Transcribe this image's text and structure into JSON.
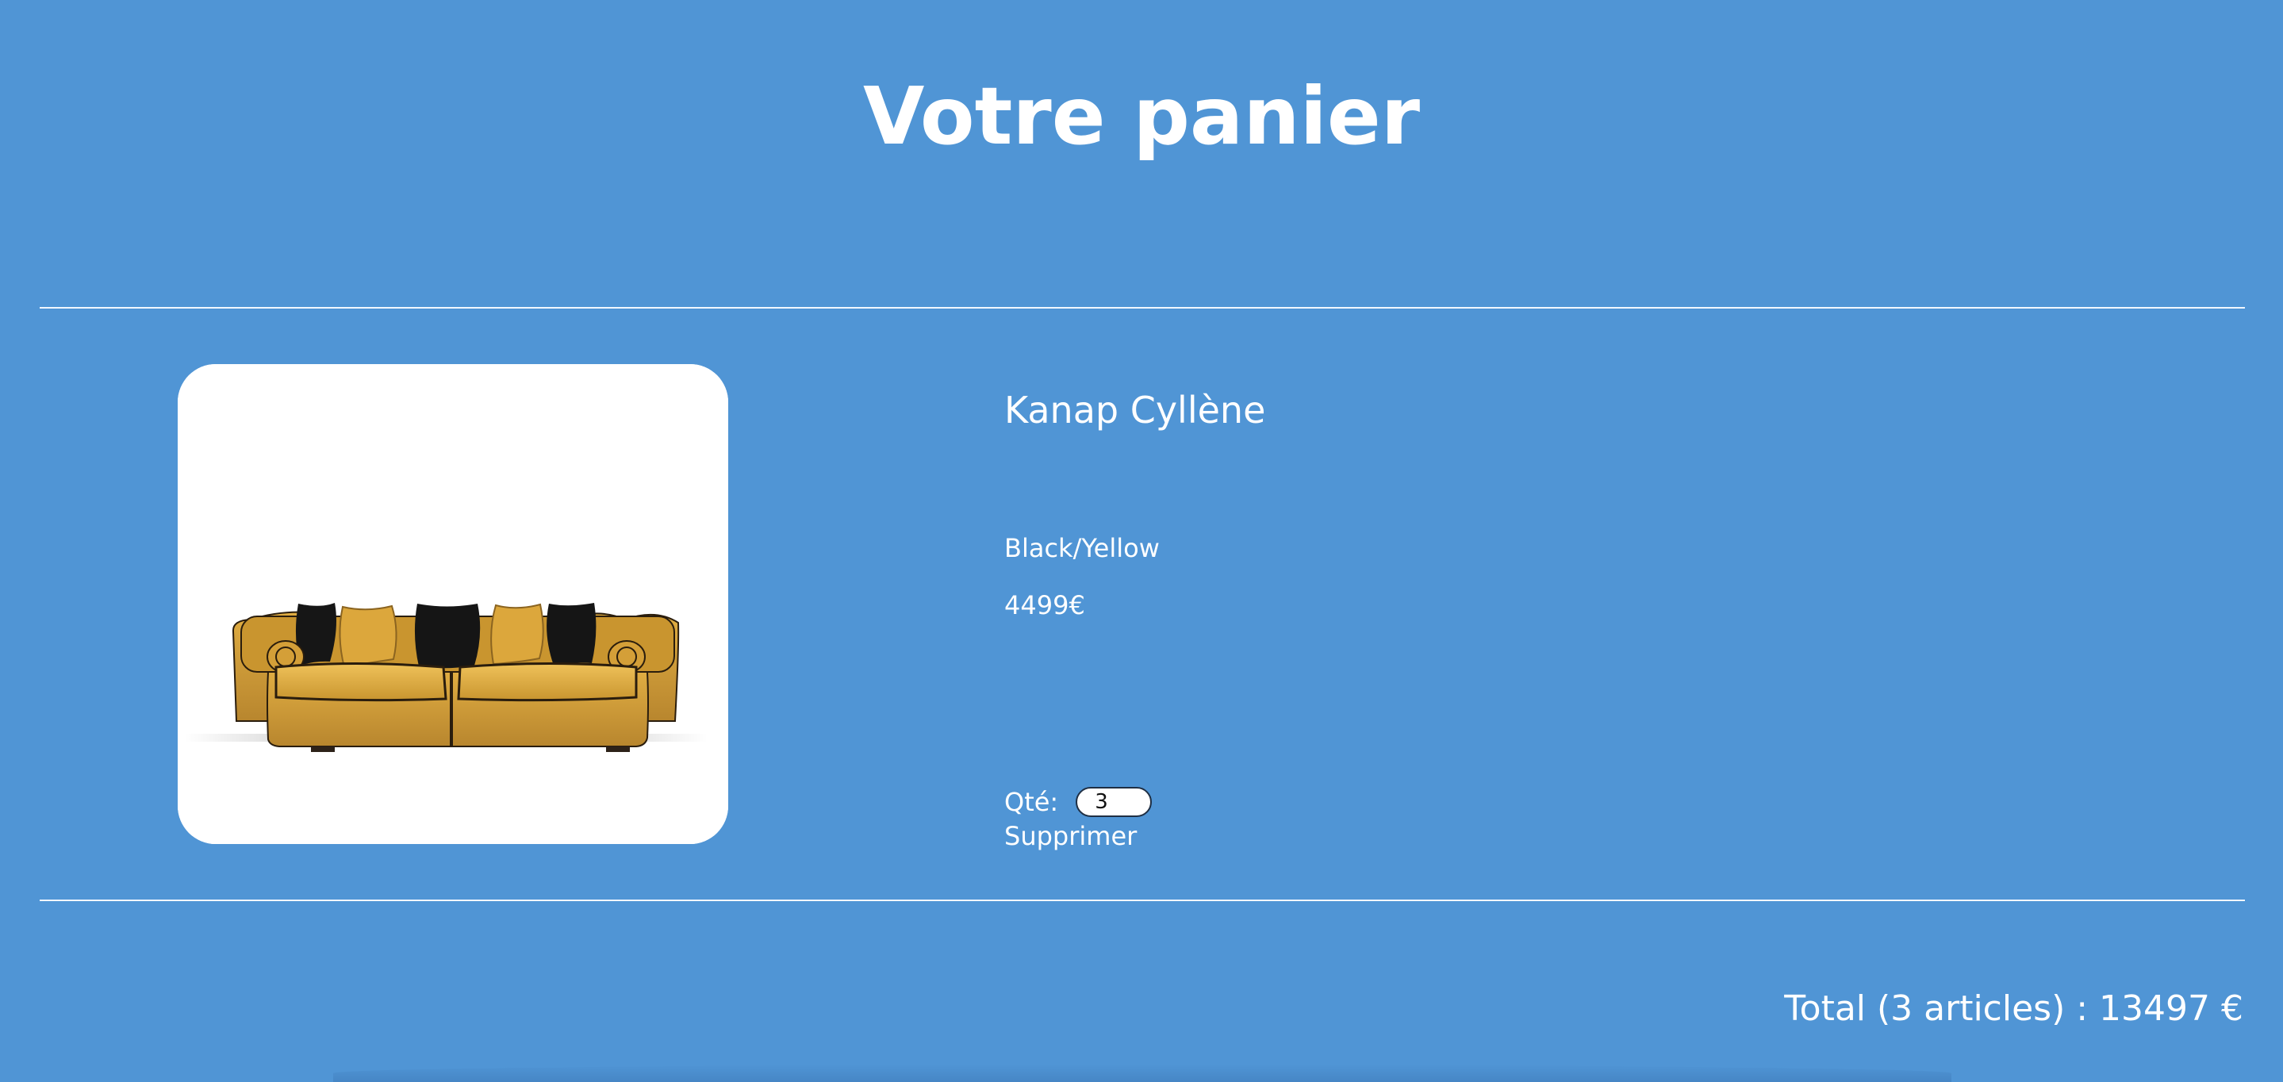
{
  "header": {
    "title": "Votre panier"
  },
  "cart": {
    "items": [
      {
        "name": "Kanap Cyllène",
        "color": "Black/Yellow",
        "price": "4499€",
        "quantity_label": "Qté:",
        "quantity_value": "3",
        "delete_label": "Supprimer",
        "image_icon": "sofa-image"
      }
    ],
    "total_label": "Total (3 articles) : 13497 €"
  },
  "colors": {
    "background": "#5095d5",
    "text": "#ffffff",
    "card": "#ffffff",
    "sofa_body": "#d6a33a",
    "cushion_dark": "#1b1b1b"
  }
}
